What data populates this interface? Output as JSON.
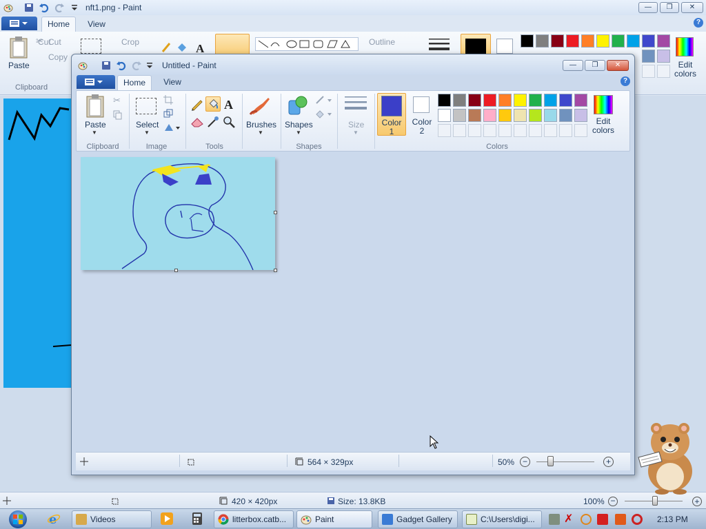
{
  "background_window": {
    "title": "nft1.png - Paint",
    "tabs": [
      {
        "label": "Home"
      },
      {
        "label": "View"
      }
    ],
    "ribbon": {
      "paste_label": "Paste",
      "cut_label": "Cut",
      "copy_label": "Copy",
      "crop_label": "Crop",
      "outline_label": "Outline",
      "clipboard_group": "Clipboard",
      "edit_colors_label": "Edit colors"
    },
    "status": {
      "dimensions": "420 × 420px",
      "size": "Size: 13.8KB",
      "zoom": "100%"
    }
  },
  "foreground_window": {
    "title": "Untitled - Paint",
    "tabs": [
      {
        "label": "Home"
      },
      {
        "label": "View"
      }
    ],
    "help_glyph": "?",
    "ribbon": {
      "groups": {
        "clipboard": "Clipboard",
        "image": "Image",
        "tools": "Tools",
        "shapes": "Shapes",
        "colors": "Colors"
      },
      "paste_label": "Paste",
      "select_label": "Select",
      "brushes_label": "Brushes",
      "shapes_label": "Shapes",
      "size_label": "Size",
      "color1_label": "Color",
      "color1_num": "1",
      "color2_label": "Color",
      "color2_num": "2",
      "edit_colors_label": "Edit",
      "edit_colors_label2": "colors",
      "color1_value": "#3b3fc8",
      "color2_value": "#ffffff",
      "palette_row1": [
        "#000000",
        "#7f7f7f",
        "#880015",
        "#ed1c24",
        "#ff7f27",
        "#fff200",
        "#22b14c",
        "#00a2e8",
        "#3f48cc",
        "#a349a4"
      ],
      "palette_row2": [
        "#ffffff",
        "#c3c3c3",
        "#b97a57",
        "#ffaec9",
        "#ffc90e",
        "#efe4b0",
        "#b5e61d",
        "#99d9ea",
        "#7092be",
        "#c8bfe7"
      ]
    },
    "status": {
      "dimensions": "564 × 329px",
      "zoom": "50%"
    }
  },
  "taskbar": {
    "items": [
      {
        "label": "Videos"
      },
      {
        "label": "litterbox.catb..."
      },
      {
        "label": "Paint"
      },
      {
        "label": "Gadget Gallery"
      },
      {
        "label": "C:\\Users\\digi..."
      }
    ],
    "clock": "2:13 PM"
  }
}
